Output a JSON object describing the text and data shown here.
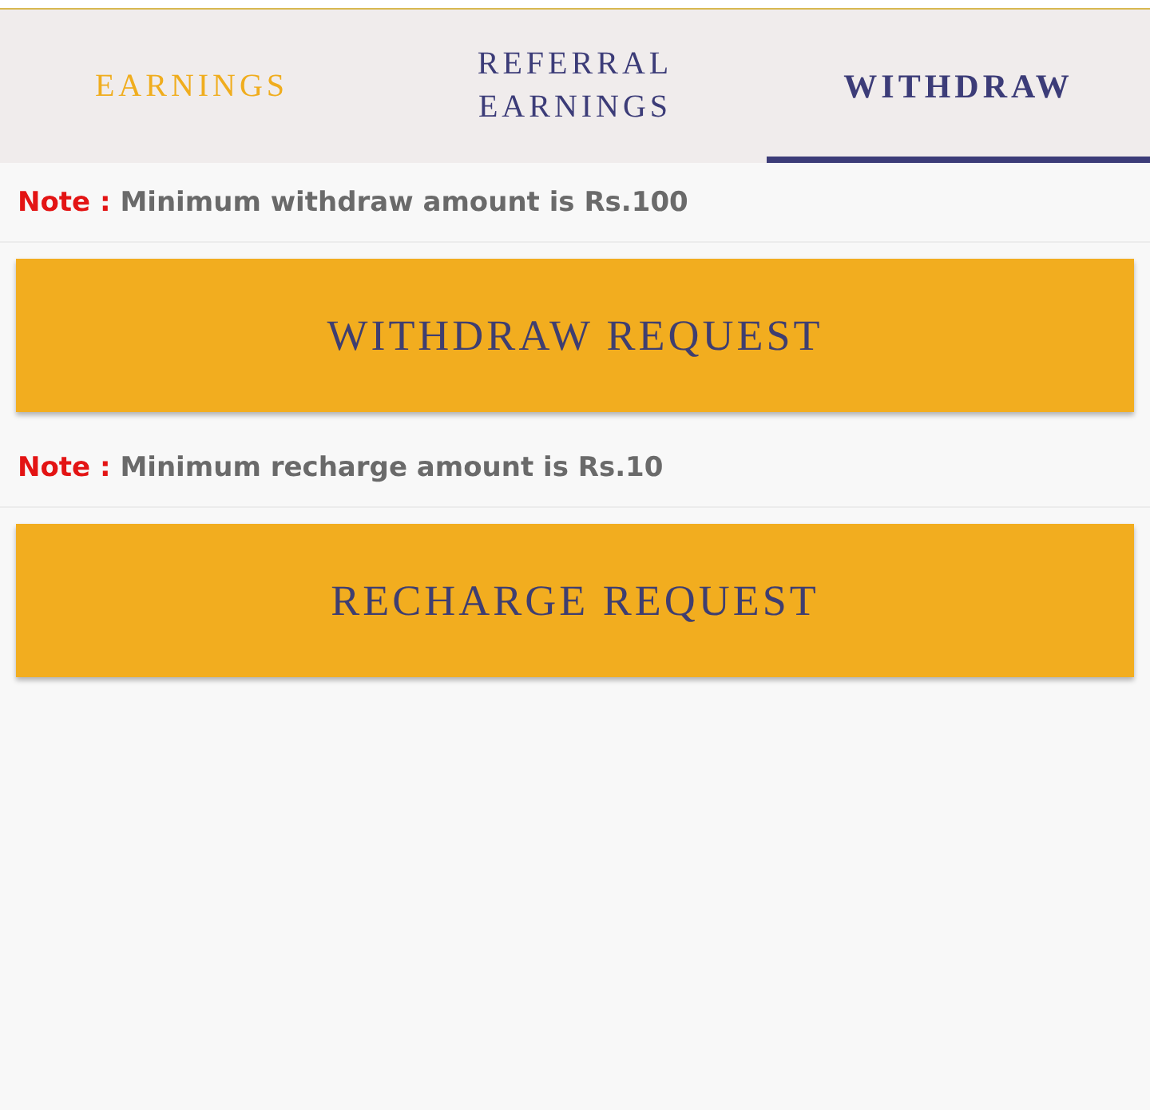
{
  "tabs": [
    {
      "label": "EARNINGS",
      "selected": false,
      "color": "#f0ad1e"
    },
    {
      "label": "REFERRAL EARNINGS",
      "selected": false,
      "color": "#3c3c78"
    },
    {
      "label": "WITHDRAW",
      "selected": true,
      "color": "#3c3c78"
    }
  ],
  "sections": [
    {
      "note": {
        "label": "Note :",
        "text": "Minimum withdraw amount is Rs.100"
      },
      "button": "WITHDRAW REQUEST"
    },
    {
      "note": {
        "label": "Note :",
        "text": "Minimum recharge amount is Rs.10"
      },
      "button": "RECHARGE REQUEST"
    }
  ]
}
